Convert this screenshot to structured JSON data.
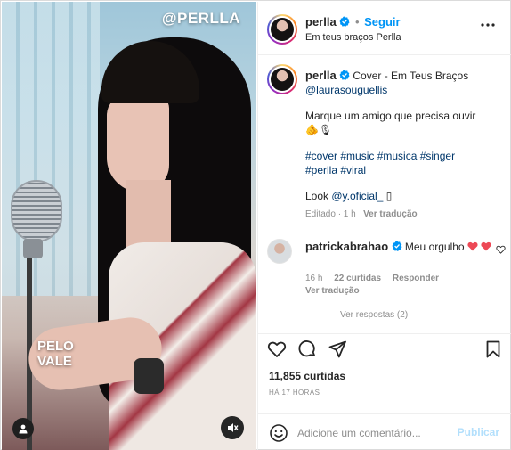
{
  "media": {
    "handle_overlay": "@PERLLA",
    "text_overlay": [
      "PELO",
      "VALE"
    ]
  },
  "header": {
    "username": "perlla",
    "separator": "•",
    "follow_label": "Seguir",
    "audio": "Em teus braços Perlla",
    "more_icon": "more-horizontal-icon"
  },
  "caption": {
    "username": "perlla",
    "line1": "Cover - Em Teus Braços",
    "mention": "@laurasouguellis",
    "paragraph2": "Marque um amigo que precisa ouvir",
    "paragraph2_emoji": "🫵🎙",
    "hashtags1": "#cover #music #musica #singer",
    "hashtags2": "#perlla #viral",
    "look_prefix": "Look",
    "look_mention": "@y.oficial_",
    "look_suffix": "▯",
    "meta_edited": "Editado · 1 h",
    "meta_translate": "Ver tradução"
  },
  "comment": {
    "username": "patrickabrahao",
    "text": "Meu orgulho",
    "time": "16 h",
    "likes": "22 curtidas",
    "reply": "Responder",
    "translate": "Ver tradução",
    "view_replies": "Ver respostas (2)"
  },
  "actions": {
    "icons": [
      "heart-icon",
      "comment-icon",
      "share-icon",
      "bookmark-icon"
    ]
  },
  "stats": {
    "likes": "11,855 curtidas",
    "time_ago": "HÁ 17 HORAS"
  },
  "composer": {
    "placeholder": "Adicione um comentário...",
    "publish_label": "Publicar"
  },
  "colors": {
    "brand_blue": "#0095f6",
    "link_blue": "#00376b",
    "muted": "#8e8e8e",
    "heart_red": "#ed4956",
    "publish_disabled": "#b2dffc"
  }
}
